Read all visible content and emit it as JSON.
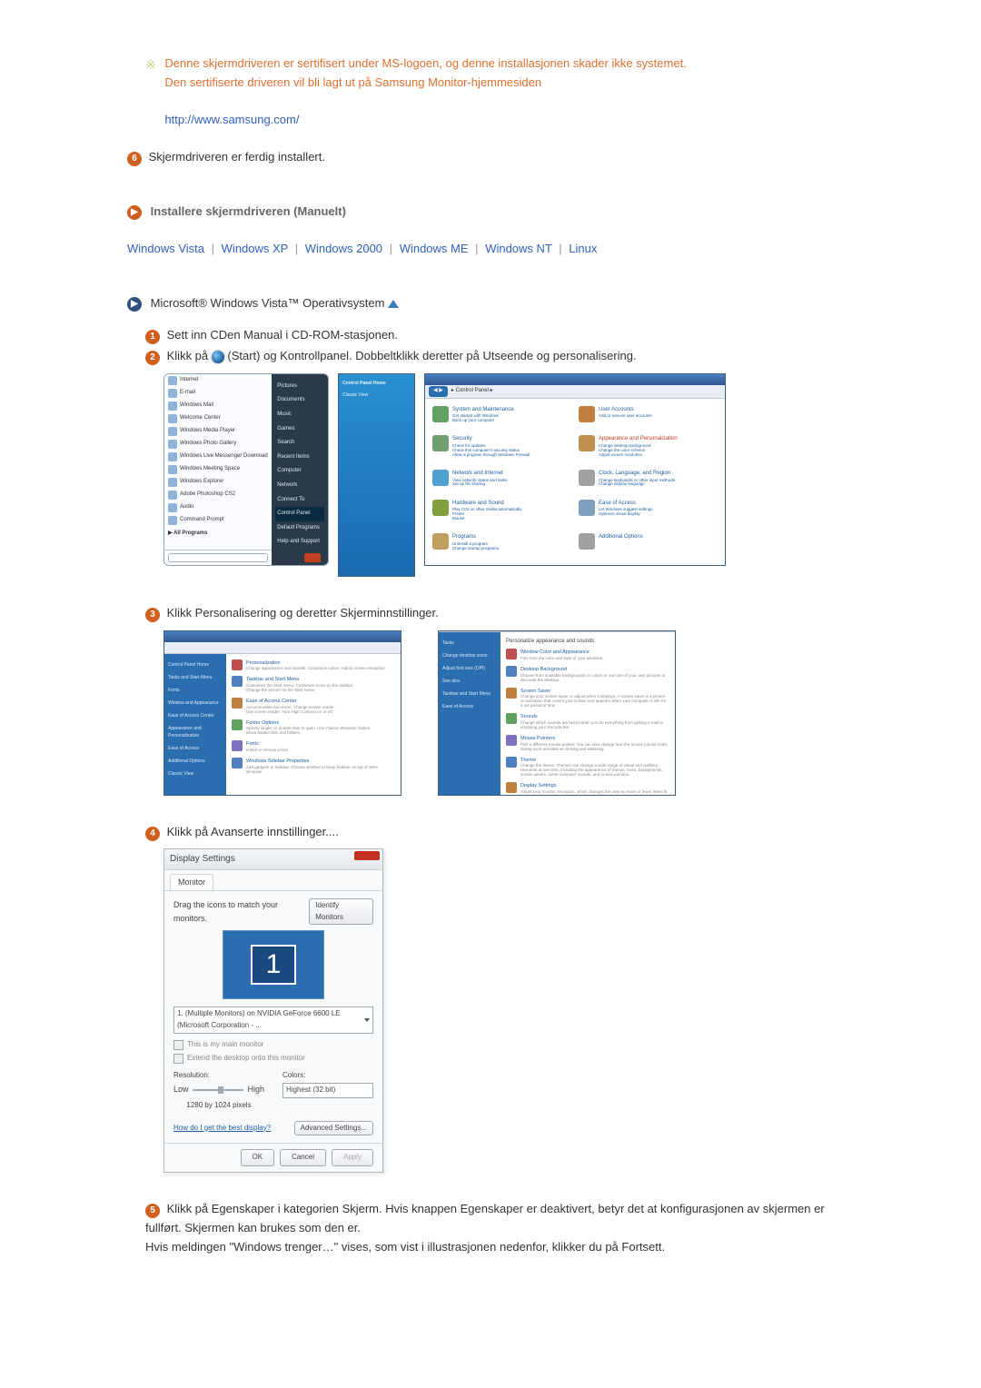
{
  "note": {
    "line1": "Denne skjermdriveren er sertifisert under MS-logoen, og denne installasjonen skader ikke systemet.",
    "line2": "Den sertifiserte driveren vil bli lagt ut på Samsung Monitor-hjemmesiden",
    "url": "http://www.samsung.com/"
  },
  "step6": {
    "num": "6",
    "text": "Skjermdriveren er ferdig installert."
  },
  "manual": {
    "title": "Installere skjermdriveren (Manuelt)"
  },
  "oslinks": {
    "vista": "Windows Vista",
    "xp": "Windows XP",
    "w2000": "Windows 2000",
    "me": "Windows ME",
    "nt": "Windows NT",
    "linux": "Linux"
  },
  "vistaHeading": "Microsoft® Windows Vista™ Operativsystem",
  "s1": {
    "num": "1",
    "text": "Sett inn CDen Manual i CD-ROM-stasjonen."
  },
  "s2": {
    "num": "2",
    "text_a": "Klikk på ",
    "text_b": "(Start) og Kontrollpanel. Dobbeltklikk deretter på Utseende og personalisering."
  },
  "s3": {
    "num": "3",
    "text": "Klikk Personalisering og deretter Skjerminnstillinger."
  },
  "s4": {
    "num": "4",
    "text": "Klikk på Avanserte innstillinger...."
  },
  "s5": {
    "num": "5",
    "text": "Klikk på Egenskaper i kategorien Skjerm. Hvis knappen Egenskaper er deaktivert, betyr det at konfigurasjonen av skjermen er fullført. Skjermen kan brukes som den er.\nHvis meldingen \"Windows trenger…\" vises, som vist i illustrasjonen nedenfor, klikker du på Fortsett."
  },
  "startMenu": {
    "left": [
      "Internet",
      "E-mail",
      "Windows Mail",
      "Welcome Center",
      "Windows Media Player",
      "Windows Photo Gallery",
      "Windows Live Messenger Download",
      "Windows Meeting Space",
      "Windows Explorer",
      "Adobe Photoshop CS2",
      "Audio",
      "Command Prompt"
    ],
    "all": "All Programs",
    "right": [
      "Pictures",
      "Documents",
      "Music",
      "Games",
      "Search",
      "Recent Items",
      "Computer",
      "Network",
      "Connect To",
      "Control Panel",
      "Default Programs",
      "Help and Support"
    ],
    "sel": "Control Panel"
  },
  "classic": {
    "title": "Control Panel Home",
    "item": "Classic View"
  },
  "cp": {
    "crumb": "Control Panel",
    "cats": [
      {
        "h": "System and Maintenance",
        "s": "Get started with Windows\nBack up your computer"
      },
      {
        "h": "User Accounts",
        "s": "Add or remove user accounts"
      },
      {
        "h": "Security",
        "s": "Check for updates\nCheck this computer's security status\nAllow a program through Windows Firewall"
      },
      {
        "h": "Appearance and Personalization",
        "s": "Change desktop background\nChange the color scheme\nAdjust screen resolution",
        "hl": true
      },
      {
        "h": "Network and Internet",
        "s": "View network status and tasks\nSet up file sharing"
      },
      {
        "h": "Clock, Language, and Region",
        "s": "Change keyboards or other input methods\nChange display language"
      },
      {
        "h": "Hardware and Sound",
        "s": "Play CDs or other media automatically\nPrinter\nMouse"
      },
      {
        "h": "Ease of Access",
        "s": "Let Windows suggest settings\nOptimize visual display"
      },
      {
        "h": "Programs",
        "s": "Uninstall a program\nChange startup programs"
      },
      {
        "h": "Additional Options",
        "s": ""
      }
    ]
  },
  "pers1": {
    "side": [
      "Control Panel Home",
      "Tasks and Start Menu",
      "Fonts",
      "Window and Appearance",
      "Ease of Access Center",
      "Appearance and Personalization",
      "Ease of Access",
      "Additional Options",
      "Classic View"
    ],
    "items": [
      {
        "h": "Personalization",
        "d": "Change appearance and sounds. Customize colors. Adjust screen resolution."
      },
      {
        "h": "Taskbar and Start Menu",
        "d": "Customize the Start menu. Customize icons on the taskbar.\nChange the picture on the Start menu."
      },
      {
        "h": "Ease of Access Center",
        "d": "Accommodate low vision. Change screen reader.\nUse screen reader. Turn High Contrast on or off."
      },
      {
        "h": "Folder Options",
        "d": "Specify single- or double-click to open. Use Classic Windows folders.\nShow hidden files and folders."
      },
      {
        "h": "Fonts",
        "d": "Install or remove a font."
      },
      {
        "h": "Windows Sidebar Properties",
        "d": "Add gadgets to Sidebar. Choose whether to keep Sidebar on top of other windows."
      }
    ]
  },
  "pers2": {
    "side": [
      "Tasks",
      "Change desktop icons",
      "Adjust font size (DPI)",
      "See also",
      "Taskbar and Start Menu",
      "Ease of Access"
    ],
    "heading": "Personalize appearance and sounds",
    "items": [
      {
        "h": "Window Color and Appearance",
        "d": "Fine tune the color and style of your windows."
      },
      {
        "h": "Desktop Background",
        "d": "Choose from available backgrounds or colors or use one of your own pictures to decorate the desktop."
      },
      {
        "h": "Screen Saver",
        "d": "Change your screen saver or adjust when it displays. A screen saver is a picture or animation that covers your screen and appears when your computer is idle for a set period of time."
      },
      {
        "h": "Sounds",
        "d": "Change which sounds are heard when you do everything from getting e-mail to emptying your Recycle Bin."
      },
      {
        "h": "Mouse Pointers",
        "d": "Pick a different mouse pointer. You can also change how the mouse pointer looks during such activities as clicking and selecting."
      },
      {
        "h": "Theme",
        "d": "Change the theme. Themes can change a wide range of visual and auditory elements at one time, including the appearance of menus, icons, backgrounds, screen savers, some computer sounds, and mouse pointers."
      },
      {
        "h": "Display Settings",
        "d": "Adjust your monitor resolution, which changes the view so more or fewer items fit on the screen. You can also control monitor flicker (refresh rate)."
      }
    ]
  },
  "disp": {
    "title": "Display Settings",
    "tab": "Monitor",
    "drag": "Drag the icons to match your monitors.",
    "identify": "Identify Monitors",
    "mon": "1",
    "sel": "1. (Multiple Monitors) on NVIDIA GeForce 6600 LE (Microsoft Corporation - ...",
    "check1": "This is my main monitor",
    "check2": "Extend the desktop onto this monitor",
    "resLabel": "Resolution:",
    "low": "Low",
    "high": "High",
    "resVal": "1280 by 1024 pixels",
    "colLabel": "Colors:",
    "colVal": "Highest (32 bit)",
    "help": "How do I get the best display?",
    "adv": "Advanced Settings...",
    "ok": "OK",
    "cancel": "Cancel",
    "apply": "Apply"
  }
}
